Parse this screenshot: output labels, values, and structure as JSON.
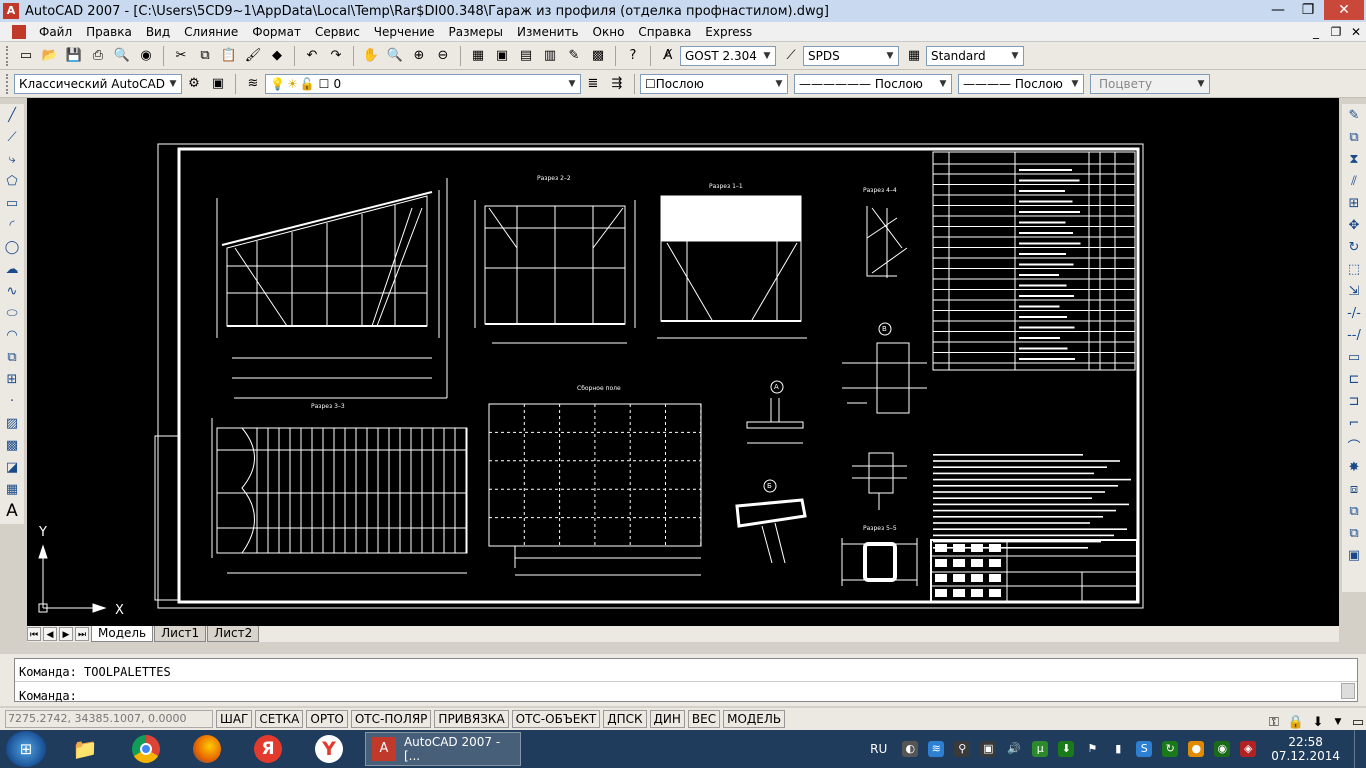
{
  "window": {
    "title": "AutoCAD 2007 - [C:\\Users\\5CD9~1\\AppData\\Local\\Temp\\Rar$DI00.348\\Гараж из профиля (отделка профнастилом).dwg]",
    "minimize": "—",
    "maximize": "❐",
    "close": "✕",
    "doc_minimize": "_",
    "doc_restore": "❐",
    "doc_close": "✕"
  },
  "menu": [
    "Файл",
    "Правка",
    "Вид",
    "Слияние",
    "Формат",
    "Сервис",
    "Черчение",
    "Размеры",
    "Изменить",
    "Окно",
    "Справка",
    "Express"
  ],
  "toolbar1": {
    "buttons": [
      {
        "name": "new-icon",
        "glyph": "▭"
      },
      {
        "name": "open-icon",
        "glyph": "📂"
      },
      {
        "name": "save-icon",
        "glyph": "💾"
      },
      {
        "name": "print-icon",
        "glyph": "⎙"
      },
      {
        "name": "preview-icon",
        "glyph": "🔍"
      },
      {
        "name": "publish-icon",
        "glyph": "◉"
      },
      {
        "name": "cut-icon",
        "glyph": "✂"
      },
      {
        "name": "copy-icon",
        "glyph": "⧉"
      },
      {
        "name": "paste-icon",
        "glyph": "📋"
      },
      {
        "name": "matchprop-icon",
        "glyph": "🖌"
      },
      {
        "name": "blockedit-icon",
        "glyph": "◆"
      },
      {
        "name": "undo-icon",
        "glyph": "↶"
      },
      {
        "name": "redo-icon",
        "glyph": "↷"
      },
      {
        "name": "pan-icon",
        "glyph": "✋"
      },
      {
        "name": "zoom-realtime-icon",
        "glyph": "🔍"
      },
      {
        "name": "zoom-window-icon",
        "glyph": "⊕"
      },
      {
        "name": "zoom-previous-icon",
        "glyph": "⊖"
      },
      {
        "name": "properties-icon",
        "glyph": "▦"
      },
      {
        "name": "designcenter-icon",
        "glyph": "▣"
      },
      {
        "name": "toolpalettes-icon",
        "glyph": "▤"
      },
      {
        "name": "sheetset-icon",
        "glyph": "▥"
      },
      {
        "name": "markup-icon",
        "glyph": "✎"
      },
      {
        "name": "calculator-icon",
        "glyph": "▩"
      },
      {
        "name": "help-icon",
        "glyph": "?"
      }
    ],
    "text_style": "GOST 2.304",
    "dim_style": "SPDS",
    "table_style": "Standard"
  },
  "toolbar2": {
    "workspace": "Классический AutoCAD",
    "layer": "0",
    "color": "Послою",
    "linetype": "Послою",
    "lineweight": "Послою",
    "plotstyle": "Поцвету"
  },
  "layout_tabs": [
    "Модель",
    "Лист1",
    "Лист2"
  ],
  "nav_arrows": [
    "⏮",
    "◀",
    "▶",
    "⏭"
  ],
  "command": {
    "history": "Команда:  TOOLPALETTES",
    "prompt": "Команда:"
  },
  "status": {
    "coords": "7275.2742, 34385.1007, 0.0000",
    "buttons": [
      "ШАГ",
      "СЕТКА",
      "ОРТО",
      "ОТС-ПОЛЯР",
      "ПРИВЯЗКА",
      "ОТС-ОБЪЕКТ",
      "ДПСК",
      "ДИН",
      "ВЕС",
      "МОДЕЛЬ"
    ]
  },
  "drawing": {
    "ucs_x": "X",
    "ucs_y": "Y",
    "views": [
      "Разрез 2–2",
      "Разрез 1–1",
      "Разрез 4–4",
      "Разрез 3–3",
      "Сборное поле",
      "Разрез 5–5"
    ],
    "callouts": [
      "А",
      "Б",
      "В"
    ]
  },
  "taskbar": {
    "active_app": "AutoCAD 2007 - [...",
    "lang": "RU",
    "time": "22:58",
    "date": "07.12.2014"
  },
  "colors": {
    "canvas": "#000000",
    "line": "#ffffff",
    "taskbar": "#1f3c5c",
    "title": "#c9daf0"
  }
}
